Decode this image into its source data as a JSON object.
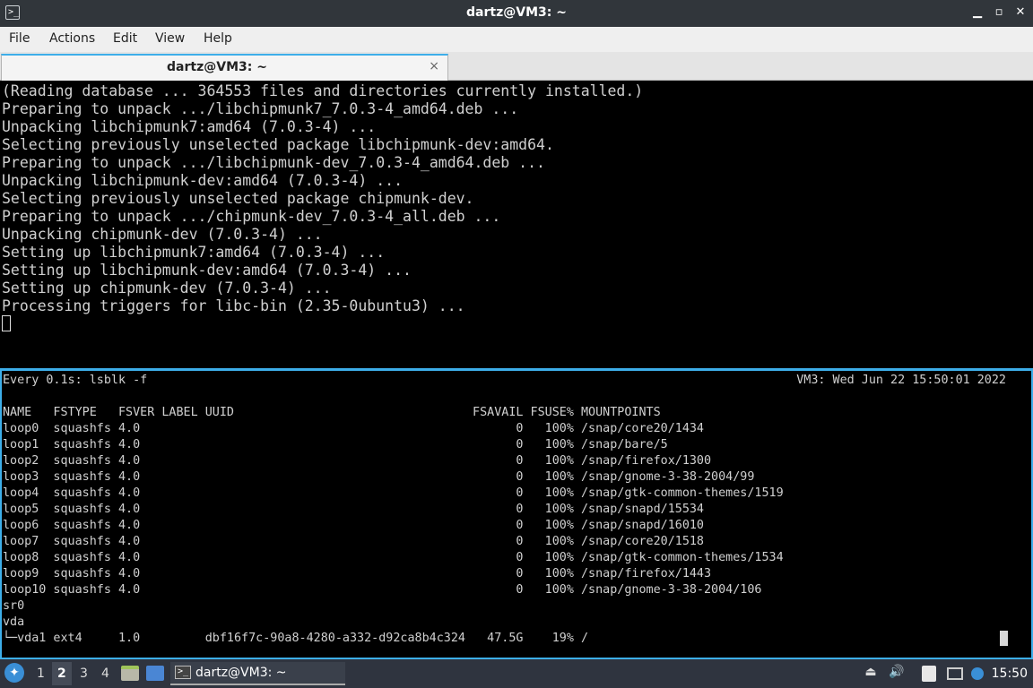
{
  "window": {
    "title": "dartz@VM3: ~",
    "app_icon": ">_",
    "minimize_icon": "minimize-icon",
    "maximize_icon": "maximize-icon",
    "close_icon": "close-icon"
  },
  "menubar": {
    "items": [
      "File",
      "Actions",
      "Edit",
      "View",
      "Help"
    ]
  },
  "tab": {
    "title": "dartz@VM3: ~",
    "close_glyph": "×"
  },
  "terminal_top": {
    "lines": [
      "(Reading database ... 364553 files and directories currently installed.)",
      "Preparing to unpack .../libchipmunk7_7.0.3-4_amd64.deb ...",
      "Unpacking libchipmunk7:amd64 (7.0.3-4) ...",
      "Selecting previously unselected package libchipmunk-dev:amd64.",
      "Preparing to unpack .../libchipmunk-dev_7.0.3-4_amd64.deb ...",
      "Unpacking libchipmunk-dev:amd64 (7.0.3-4) ...",
      "Selecting previously unselected package chipmunk-dev.",
      "Preparing to unpack .../chipmunk-dev_7.0.3-4_all.deb ...",
      "Unpacking chipmunk-dev (7.0.3-4) ...",
      "Setting up libchipmunk7:amd64 (7.0.3-4) ...",
      "Setting up libchipmunk-dev:amd64 (7.0.3-4) ...",
      "Setting up chipmunk-dev (7.0.3-4) ...",
      "Processing triggers for libc-bin (2.35-0ubuntu3) ..."
    ]
  },
  "terminal_bottom": {
    "watch_header": "Every 0.1s: lsblk -f",
    "watch_status": "VM3: Wed Jun 22 15:50:01 2022",
    "lines": [
      "NAME   FSTYPE   FSVER LABEL UUID                                 FSAVAIL FSUSE% MOUNTPOINTS",
      "loop0  squashfs 4.0                                                    0   100% /snap/core20/1434",
      "loop1  squashfs 4.0                                                    0   100% /snap/bare/5",
      "loop2  squashfs 4.0                                                    0   100% /snap/firefox/1300",
      "loop3  squashfs 4.0                                                    0   100% /snap/gnome-3-38-2004/99",
      "loop4  squashfs 4.0                                                    0   100% /snap/gtk-common-themes/1519",
      "loop5  squashfs 4.0                                                    0   100% /snap/snapd/15534",
      "loop6  squashfs 4.0                                                    0   100% /snap/snapd/16010",
      "loop7  squashfs 4.0                                                    0   100% /snap/core20/1518",
      "loop8  squashfs 4.0                                                    0   100% /snap/gtk-common-themes/1534",
      "loop9  squashfs 4.0                                                    0   100% /snap/firefox/1443",
      "loop10 squashfs 4.0                                                    0   100% /snap/gnome-3-38-2004/106",
      "sr0",
      "vda",
      "└─vda1 ext4     1.0         dbf16f7c-90a8-4280-a332-d92ca8b4c324   47.5G    19% /"
    ]
  },
  "taskbar": {
    "start_icon": "lxqt-start-icon",
    "workspaces": [
      "1",
      "2",
      "3",
      "4"
    ],
    "active_workspace": "2",
    "launchers": [
      "file-manager-icon",
      "desktop-icon"
    ],
    "task_label": "dartz@VM3: ~",
    "tray_icons": [
      "eject-icon",
      "volume-icon",
      "clipboard-icon",
      "network-icon",
      "update-notifier-icon"
    ],
    "clock": "15:50"
  }
}
